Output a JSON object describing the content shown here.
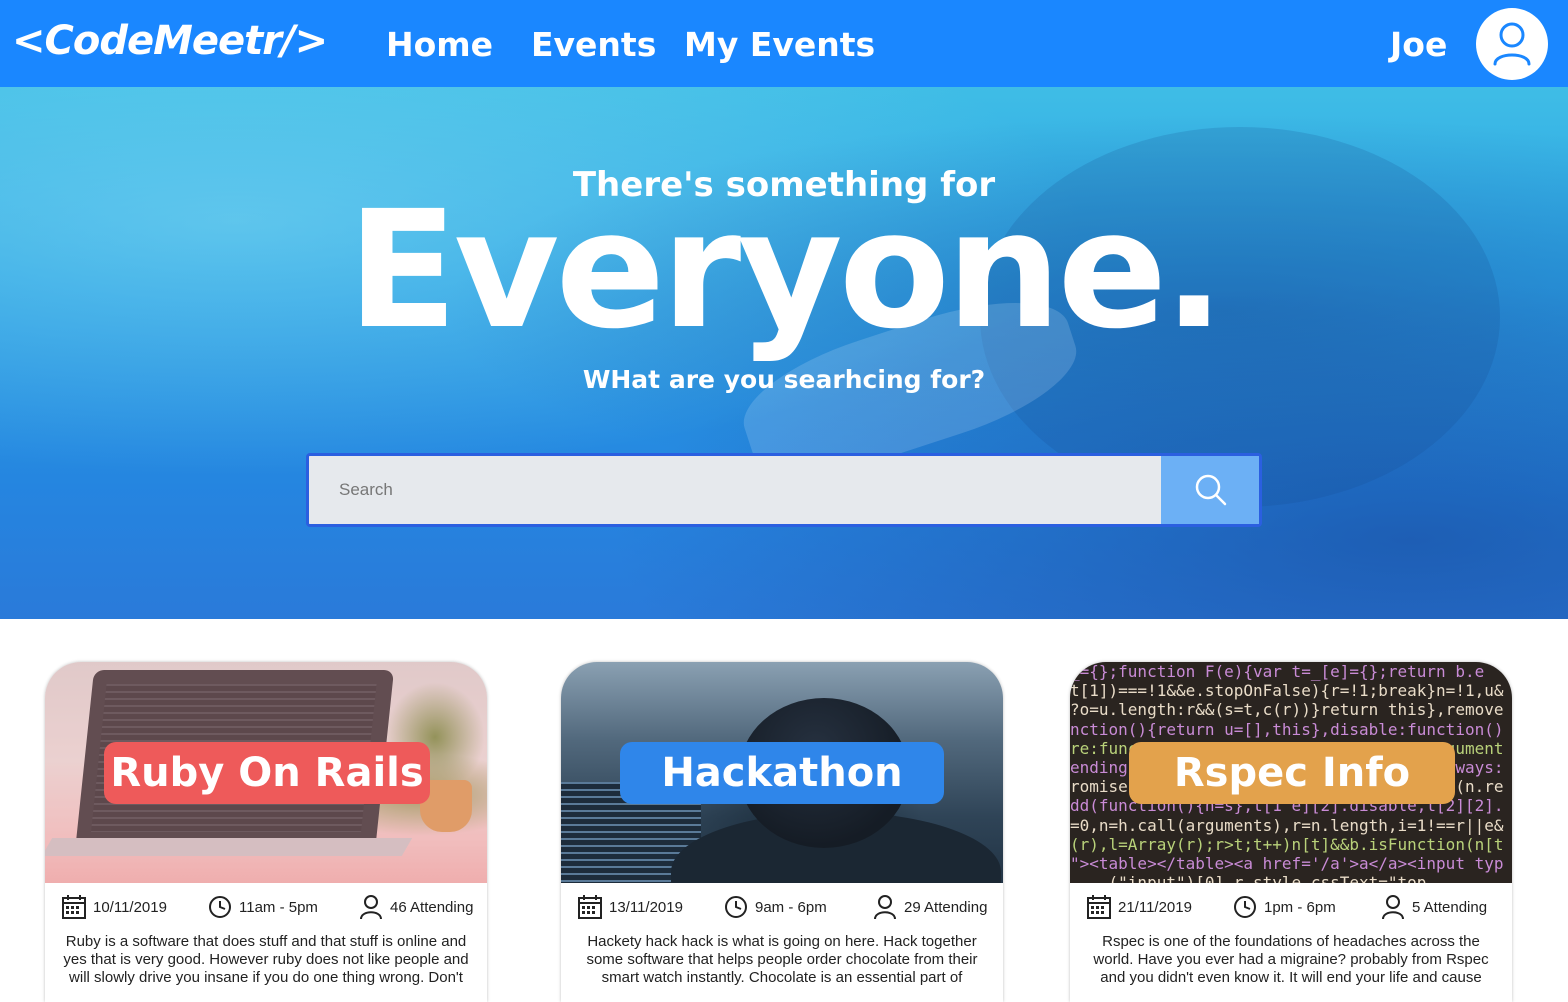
{
  "nav": {
    "logo": "<CodeMeetr/>",
    "links": [
      "Home",
      "Events",
      "My Events"
    ],
    "user_name": "Joe",
    "avatar_icon": "user-icon",
    "color": "#1a87ff"
  },
  "hero": {
    "subtitle": "There's something for",
    "title": "Everyone.",
    "question": "WHat are you searhcing for?",
    "search_placeholder": "Search",
    "search_icon": "search-icon"
  },
  "events": [
    {
      "title": "Ruby On Rails",
      "label_color": "#ee5a5a",
      "date": "10/11/2019",
      "time": "11am - 5pm",
      "attending": "46 Attending",
      "description": "Ruby is a software that does stuff and that stuff is online and yes that is very good. However ruby does not like people and will slowly drive you insane if you do one thing wrong. Don't"
    },
    {
      "title": "Hackathon",
      "label_color": "#2f86ea",
      "date": "13/11/2019",
      "time": "9am - 6pm",
      "attending": "29 Attending",
      "description": "Hackety hack hack is what is going on here. Hack together some software that helps people order chocolate from their smart watch instantly. Chocolate is an essential part of"
    },
    {
      "title": "Rspec Info",
      "label_color": "#e3a24c",
      "date": "21/11/2019",
      "time": "1pm - 6pm",
      "attending": "5 Attending",
      "description": "Rspec is one of the foundations of headaches across the world. Have you ever had a migraine? probably from Rspec and you didn't even know it. It will end your life and cause"
    }
  ]
}
